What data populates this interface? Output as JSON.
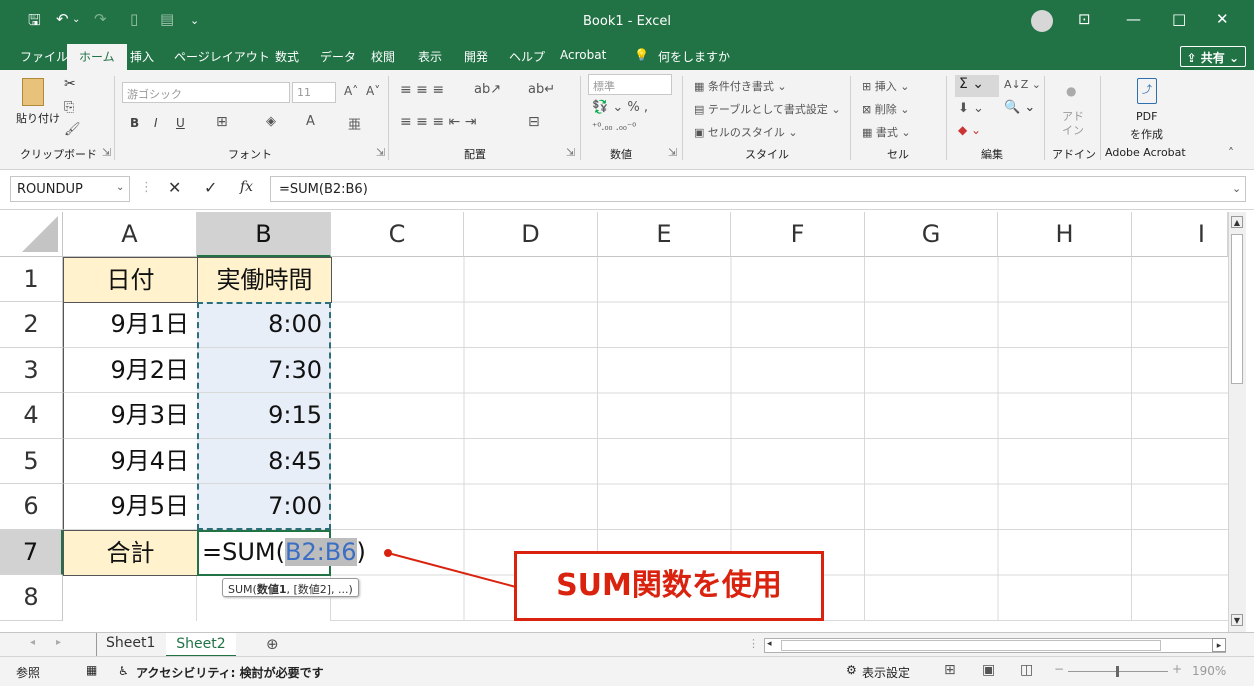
{
  "window": {
    "title": "Book1 - Excel"
  },
  "menu": {
    "items": [
      "ファイル",
      "ホーム",
      "挿入",
      "ページレイアウト",
      "数式",
      "データ",
      "校閲",
      "表示",
      "開発",
      "ヘルプ",
      "Acrobat"
    ],
    "search": "何をしますか",
    "share": "共有"
  },
  "ribbon": {
    "clipboard": {
      "paste": "貼り付け",
      "label": "クリップボード"
    },
    "font": {
      "name": "游ゴシック",
      "size": "11",
      "label": "フォント"
    },
    "alignment": {
      "label": "配置"
    },
    "number": {
      "format": "標準",
      "label": "数値"
    },
    "style": {
      "conditional": "条件付き書式",
      "table": "テーブルとして書式設定",
      "cell": "セルのスタイル",
      "label": "スタイル"
    },
    "cells": {
      "insert": "挿入",
      "delete": "削除",
      "format": "書式",
      "label": "セル"
    },
    "edit": {
      "label": "編集"
    },
    "addin": {
      "text": "アド\nイン",
      "label": "アドイン"
    },
    "acrobat": {
      "pdf": "PDF",
      "create": "を作成",
      "label": "Adobe Acrobat"
    }
  },
  "formula_bar": {
    "name_box": "ROUNDUP",
    "fx": "fx",
    "formula": "=SUM(B2:B6)"
  },
  "grid": {
    "columns": [
      "A",
      "B",
      "C",
      "D",
      "E",
      "F",
      "G",
      "H",
      "I"
    ],
    "rows": [
      "1",
      "2",
      "3",
      "4",
      "5",
      "6",
      "7",
      "8"
    ],
    "cells": {
      "A1": "日付",
      "B1": "実働時間",
      "A2": "9月1日",
      "B2": "8:00",
      "A3": "9月2日",
      "B3": "7:30",
      "A4": "9月3日",
      "B4": "9:15",
      "A5": "9月4日",
      "B5": "8:45",
      "A6": "9月5日",
      "B6": "7:00",
      "A7": "合計"
    },
    "edit_cell": {
      "prefix": "=SUM(",
      "ref": "B2:B6",
      "suffix": ")"
    },
    "tooltip": {
      "fn": "SUM(",
      "arg1": "数値1",
      "rest": ", [数値2], ...)"
    }
  },
  "annotation": {
    "text": "SUM関数を使用"
  },
  "sheets": {
    "tabs": [
      "Sheet1",
      "Sheet2"
    ],
    "active": "Sheet2"
  },
  "status": {
    "mode": "参照",
    "accessibility": "アクセシビリティ: 検討が必要です",
    "display_settings": "表示設定",
    "zoom": "190%"
  },
  "colors": {
    "excel_green": "#217346",
    "callout_red": "#d9230f",
    "ref_blue": "#3b6fc4"
  }
}
